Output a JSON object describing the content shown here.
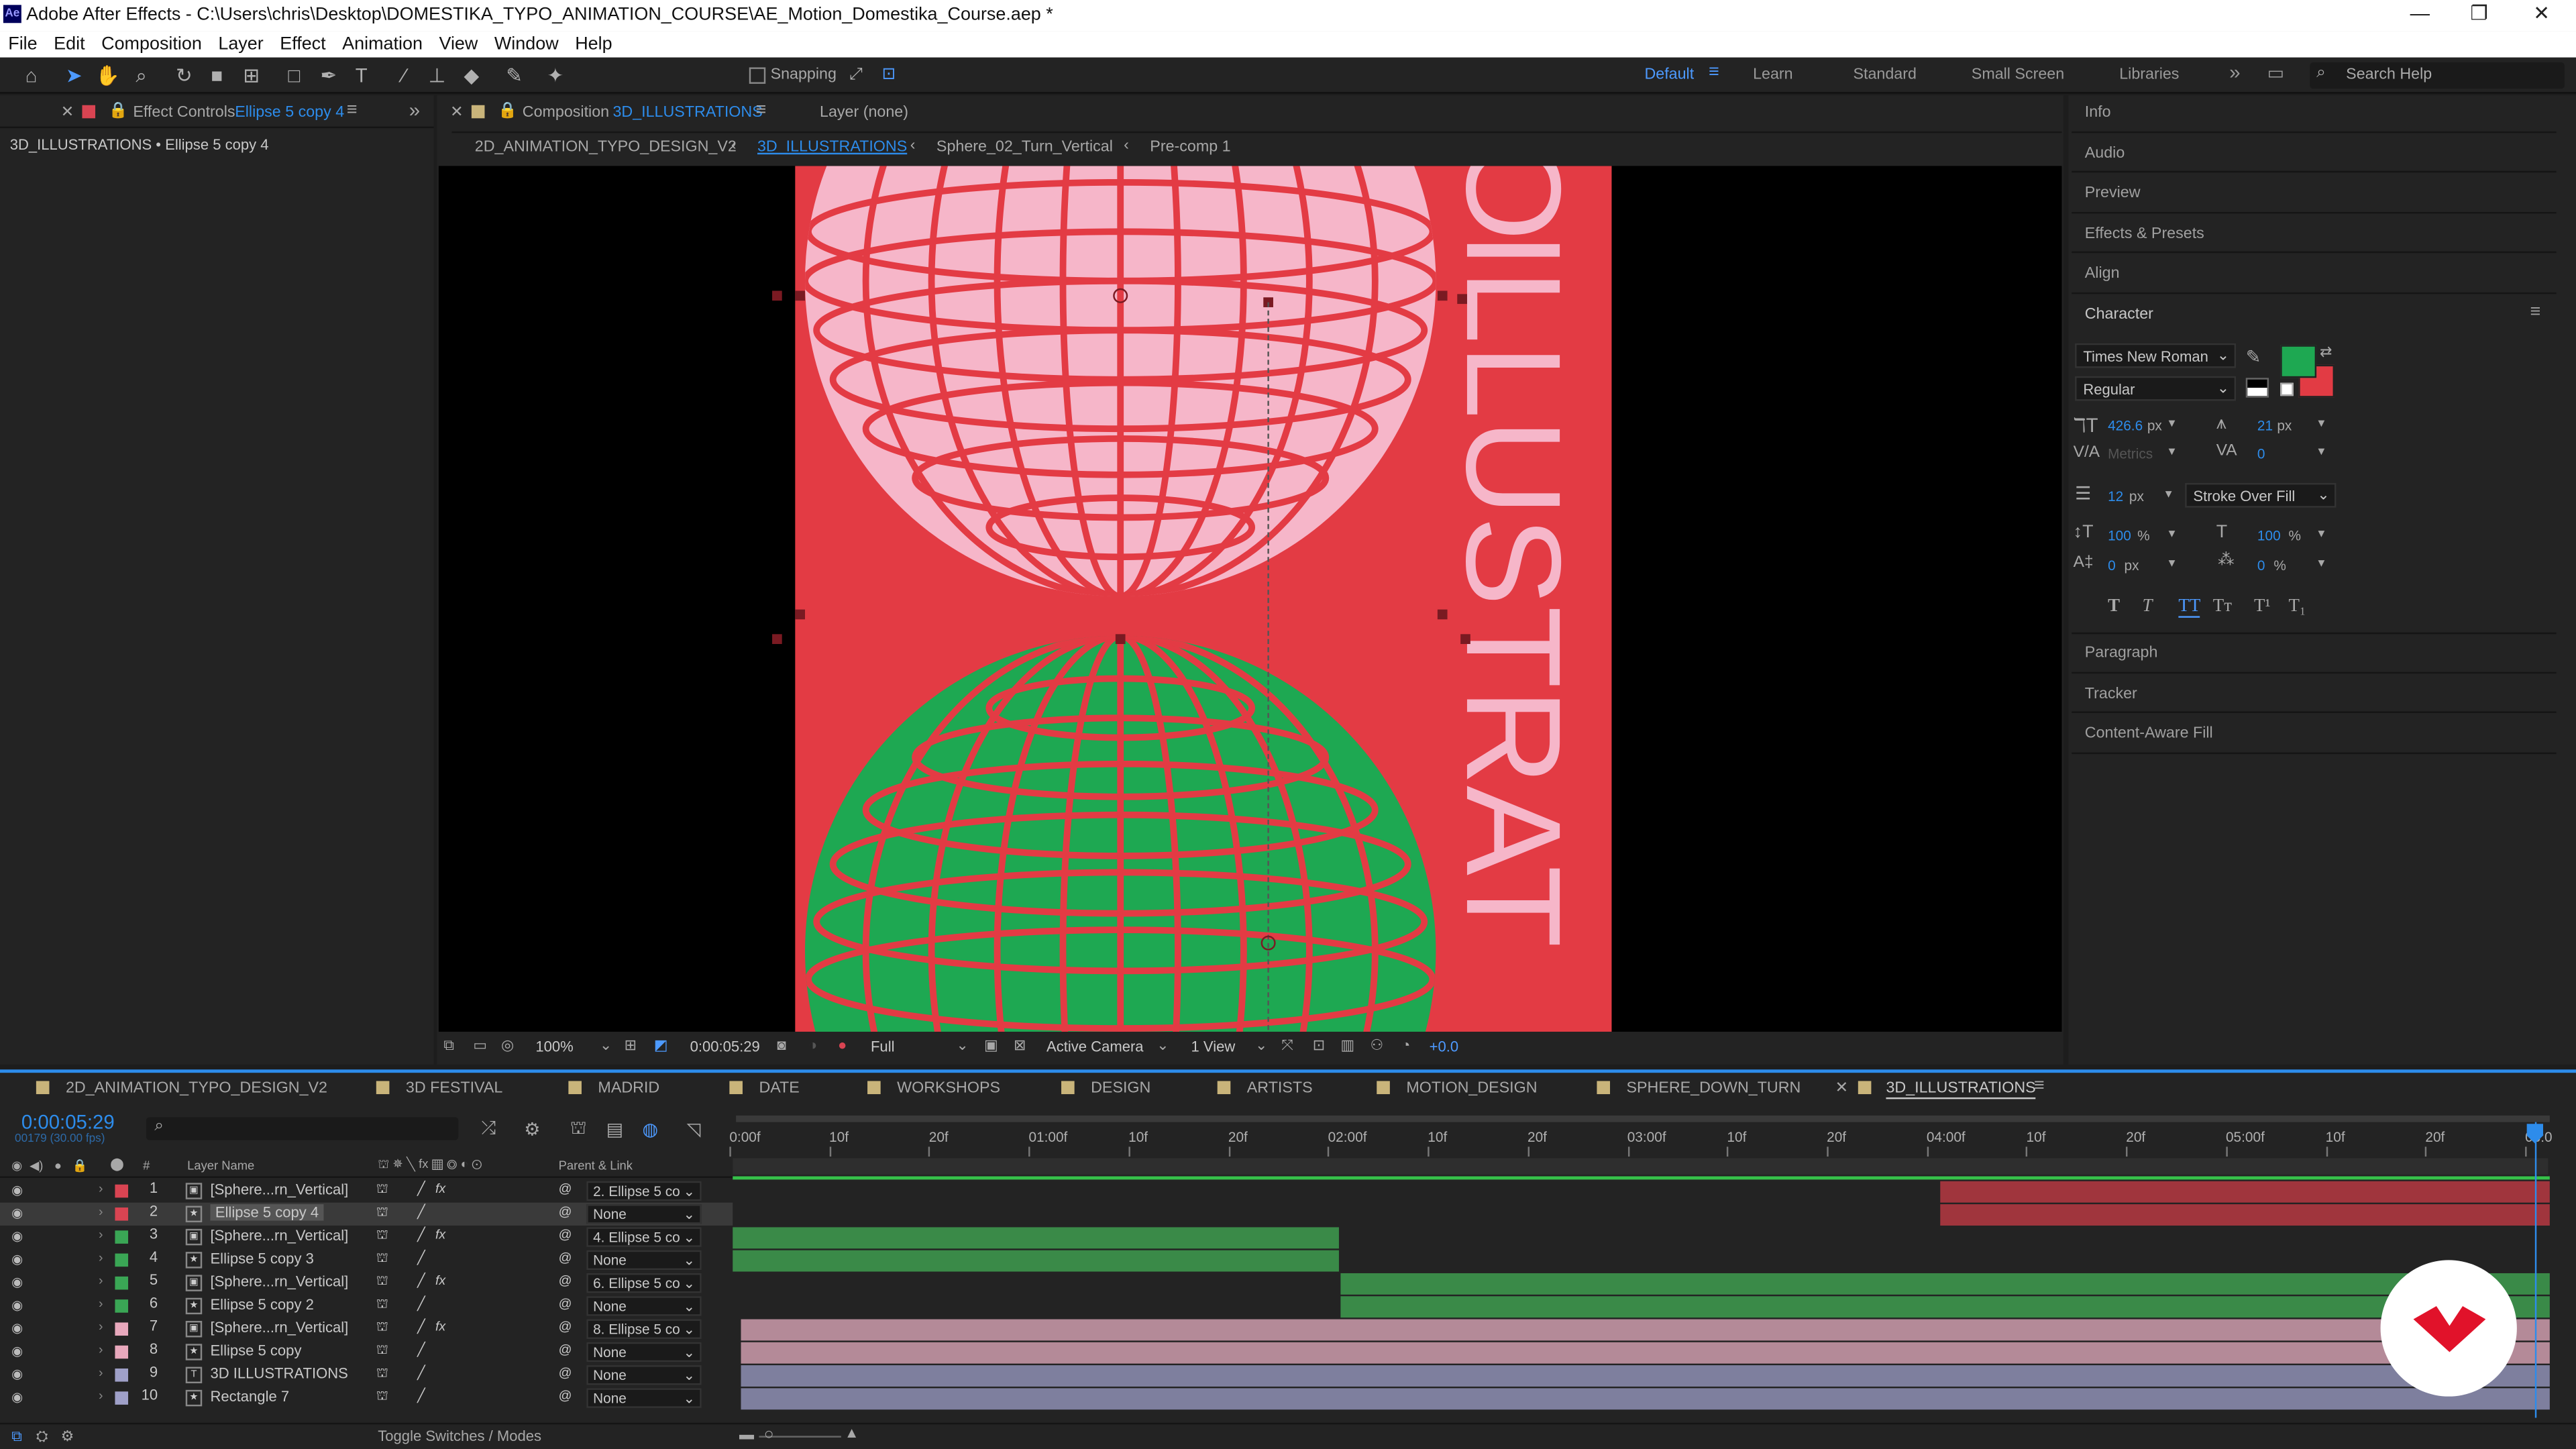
{
  "window": {
    "title": "Adobe After Effects - C:\\Users\\chris\\Desktop\\DOMESTIKA_TYPO_ANIMATION_COURSE\\AE_Motion_Domestika_Course.aep *",
    "logo": "Ae",
    "controls": [
      "—",
      "❐",
      "✕"
    ]
  },
  "menu": [
    "File",
    "Edit",
    "Composition",
    "Layer",
    "Effect",
    "Animation",
    "View",
    "Window",
    "Help"
  ],
  "toolbar": {
    "snapping": "Snapping",
    "workspaces": [
      "Default",
      "Learn",
      "Standard",
      "Small Screen",
      "Libraries"
    ],
    "search": "Search Help"
  },
  "effect_controls": {
    "tab": "Effect Controls",
    "layer": "Ellipse 5 copy 4",
    "breadcrumb": "3D_ILLUSTRATIONS • Ellipse 5 copy 4"
  },
  "composition": {
    "tab": "Composition",
    "name": "3D_ILLUSTRATIONS",
    "layer_tab": "Layer (none)",
    "flow": [
      "2D_ANIMATION_TYPO_DESIGN_V2",
      "3D_ILLUSTRATIONS",
      "Sphere_02_Turn_Vertical",
      "Pre-comp 1"
    ],
    "canvas_text": "ILLUSTRAT",
    "o_text": "O"
  },
  "viewer": {
    "zoom": "100%",
    "timecode": "0:00:05:29",
    "resolution": "Full",
    "camera": "Active Camera",
    "views": "1 View",
    "exposure": "+0.0"
  },
  "right_panels": [
    "Info",
    "Audio",
    "Preview",
    "Effects & Presets",
    "Align"
  ],
  "character": {
    "title": "Character",
    "font": "Times New Roman",
    "style": "Regular",
    "size": "426.6",
    "size_unit": "px",
    "leading": "21",
    "leading_unit": "px",
    "kerning": "Metrics",
    "tracking": "0",
    "stroke": "12",
    "stroke_unit": "px",
    "stroke_mode": "Stroke Over Fill",
    "vscale": "100",
    "vscale_unit": "%",
    "hscale": "100",
    "hscale_unit": "%",
    "baseline": "0",
    "baseline_unit": "px",
    "tsume": "0",
    "tsume_unit": "%",
    "fill_color": "#1ea852",
    "stroke_color": "#e23b44",
    "styles": [
      "T",
      "T",
      "TT",
      "Tт",
      "T¹",
      "T₁"
    ]
  },
  "more_panels": [
    "Paragraph",
    "Tracker",
    "Content-Aware Fill"
  ],
  "timeline_tabs": [
    "2D_ANIMATION_TYPO_DESIGN_V2",
    "3D FESTIVAL",
    "MADRID",
    "DATE",
    "WORKSHOPS",
    "DESIGN",
    "ARTISTS",
    "MOTION_DESIGN",
    "SPHERE_DOWN_TURN",
    "3D_ILLUSTRATIONS"
  ],
  "timeline": {
    "timecode": "0:00:05:29",
    "frames": "00179 (30.00 fps)",
    "col_layer": "Layer Name",
    "col_parent": "Parent & Link",
    "col_hash": "#",
    "toggle": "Toggle Switches / Modes"
  },
  "ruler": [
    "0:00f",
    "10f",
    "20f",
    "01:00f",
    "10f",
    "20f",
    "02:00f",
    "10f",
    "20f",
    "03:00f",
    "10f",
    "20f",
    "04:00f",
    "10f",
    "20f",
    "05:00f",
    "10f",
    "20f",
    "06:0"
  ],
  "layers": [
    {
      "num": "1",
      "name": "[Sphere...rn_Vertical]",
      "parent": "2. Ellipse 5 co",
      "color": "#d94452",
      "icon": "▣",
      "fx": true
    },
    {
      "num": "2",
      "name": "Ellipse 5 copy 4",
      "parent": "None",
      "color": "#d94452",
      "icon": "★",
      "fx": false
    },
    {
      "num": "3",
      "name": "[Sphere...rn_Vertical]",
      "parent": "4. Ellipse 5 co",
      "color": "#3aa655",
      "icon": "▣",
      "fx": true
    },
    {
      "num": "4",
      "name": "Ellipse 5 copy 3",
      "parent": "None",
      "color": "#3aa655",
      "icon": "★",
      "fx": false
    },
    {
      "num": "5",
      "name": "[Sphere...rn_Vertical]",
      "parent": "6. Ellipse 5 co",
      "color": "#3aa655",
      "icon": "▣",
      "fx": true
    },
    {
      "num": "6",
      "name": "Ellipse 5 copy 2",
      "parent": "None",
      "color": "#3aa655",
      "icon": "★",
      "fx": false
    },
    {
      "num": "7",
      "name": "[Sphere...rn_Vertical]",
      "parent": "8. Ellipse 5 co",
      "color": "#e8a8bc",
      "icon": "▣",
      "fx": true
    },
    {
      "num": "8",
      "name": "Ellipse 5 copy",
      "parent": "None",
      "color": "#e8a8bc",
      "icon": "★",
      "fx": false
    },
    {
      "num": "9",
      "name": "3D ILLUSTRATIONS",
      "parent": "None",
      "color": "#9fa0c8",
      "icon": "T",
      "fx": false
    },
    {
      "num": "10",
      "name": "Rectangle 7",
      "parent": "None",
      "color": "#9fa0c8",
      "icon": "★",
      "fx": false
    }
  ]
}
